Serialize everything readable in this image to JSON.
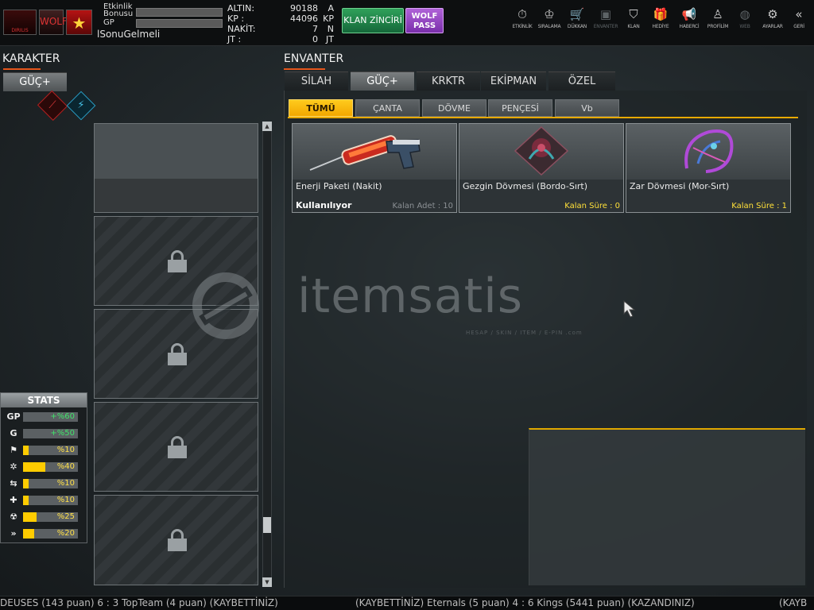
{
  "topbar": {
    "badge1_text": "DIRILIS",
    "badge2_text": "WOLF",
    "badge3_star": "★",
    "bonus_label": "Etkinlik Bonusu",
    "gp_label": "GP",
    "username": "lSonuGelmeli",
    "currency": [
      {
        "label": "ALTIN:",
        "value": "90188",
        "unit": "A"
      },
      {
        "label": "KP :",
        "value": "44096",
        "unit": "KP"
      },
      {
        "label": "NAKİT:",
        "value": "7",
        "unit": "N"
      },
      {
        "label": "JT :",
        "value": "0",
        "unit": "JT"
      }
    ],
    "klan_button": "KLAN ZİNCİRİ",
    "wolf_button": "WOLF PASS"
  },
  "nav": [
    {
      "label": "ETKİNLİK",
      "icon": "⏱"
    },
    {
      "label": "SIRALAMA",
      "icon": "♔"
    },
    {
      "label": "DÜKKAN",
      "icon": "🛒"
    },
    {
      "label": "ENVANTER",
      "icon": "▣"
    },
    {
      "label": "KLAN",
      "icon": "⛉"
    },
    {
      "label": "HEDİYE",
      "icon": "🎁"
    },
    {
      "label": "HABERCİ",
      "icon": "📢"
    },
    {
      "label": "PROFİLİM",
      "icon": "♙"
    },
    {
      "label": "WEB",
      "icon": "◍"
    },
    {
      "label": "AYARLAR",
      "icon": "⚙"
    },
    {
      "label": "GERİ",
      "icon": "«"
    }
  ],
  "character": {
    "title": "KARAKTER",
    "tab": "GÜÇ+"
  },
  "stats": {
    "title": "STATS",
    "rows": [
      {
        "icon": "GP",
        "value": "+%60",
        "fill": 0,
        "green": true
      },
      {
        "icon": "G",
        "value": "+%50",
        "fill": 0,
        "green": true
      },
      {
        "icon": "⚑",
        "value": "%10",
        "fill": 0.1,
        "green": false
      },
      {
        "icon": "✲",
        "value": "%40",
        "fill": 0.4,
        "green": false
      },
      {
        "icon": "⇆",
        "value": "%10",
        "fill": 0.1,
        "green": false
      },
      {
        "icon": "✚",
        "value": "%10",
        "fill": 0.1,
        "green": false
      },
      {
        "icon": "☢",
        "value": "%25",
        "fill": 0.25,
        "green": false
      },
      {
        "icon": "»",
        "value": "%20",
        "fill": 0.2,
        "green": false
      }
    ]
  },
  "inventory": {
    "title": "ENVANTER",
    "tabs": [
      "SİLAH",
      "GÜÇ+",
      "KRKTR",
      "EKİPMAN",
      "ÖZEL"
    ],
    "subtabs": [
      "TÜMÜ",
      "ÇANTA",
      "DÖVME",
      "PENÇESİ",
      "Vb"
    ],
    "items": [
      {
        "name": "Enerji Paketi (Nakit)",
        "status": "Kullanılıyor",
        "count": "Kalan Adet : 10"
      },
      {
        "name": "Gezgin Dövmesi (Bordo-Sırt)",
        "status": "",
        "count": "Kalan Süre : 0"
      },
      {
        "name": "Zar Dövmesi (Mor-Sırt)",
        "status": "",
        "count": "Kalan Süre : 1"
      }
    ]
  },
  "watermark": {
    "text": "itemsatis",
    "sub": "HESAP / SKIN / ITEM / E-PIN .com"
  },
  "ticker": {
    "left": "DEUSES (143 puan) 6 : 3 TopTeam (4 puan) (KAYBETTİNİZ)",
    "middle": "(KAYBETTİNİZ) Eternals (5 puan) 4 : 6 Kings (5441 puan) (KAZANDINIZ)",
    "right": "(KAYB"
  },
  "colors": {
    "accent_yellow": "#f2a700",
    "accent_orange": "#e4551b",
    "klan_green": "#2fa05a",
    "wolf_purple": "#b063d8"
  }
}
